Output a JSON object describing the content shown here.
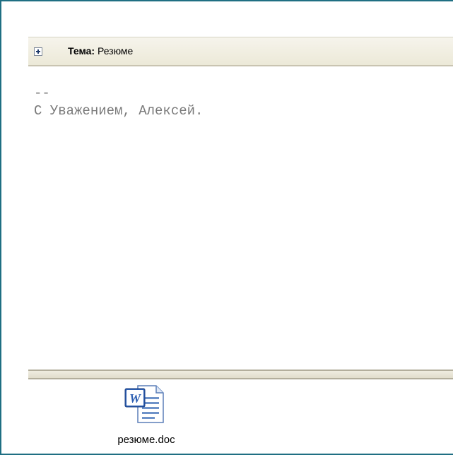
{
  "header": {
    "subject_label": "Тема:",
    "subject_value": "Резюме"
  },
  "message": {
    "signature_separator": "--",
    "signature_line": "С Уважением, Алексей."
  },
  "attachments": [
    {
      "name": "резюме.doc",
      "icon": "word-document-icon"
    }
  ],
  "colors": {
    "frame_border": "#1f6f83",
    "header_bar": "#ece9d8",
    "body_text": "#7a7a7a"
  }
}
